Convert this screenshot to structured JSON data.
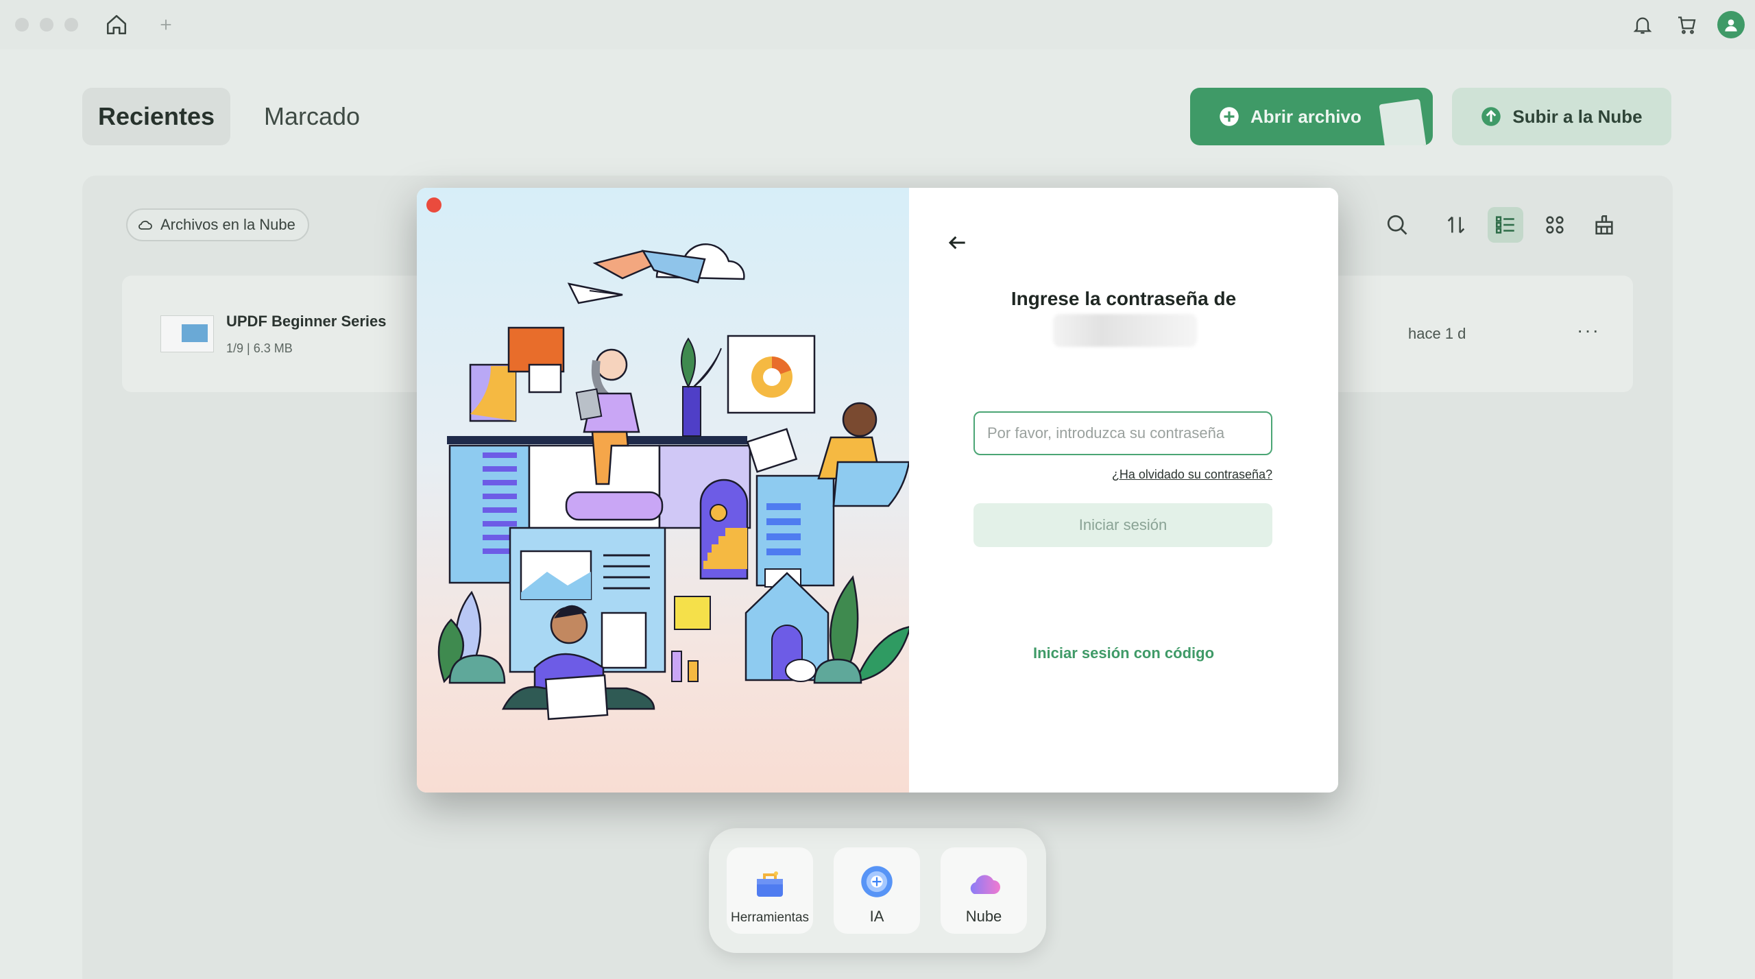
{
  "tabs": {
    "recent": "Recientes",
    "marked": "Marcado"
  },
  "actions": {
    "open_file": "Abrir archivo",
    "upload_cloud": "Subir a la Nube"
  },
  "filter": {
    "cloud_files": "Archivos en la Nube"
  },
  "file": {
    "name": "UPDF Beginner Series",
    "pages": "1/9",
    "size": "6.3 MB",
    "time": "hace 1 d",
    "more": "···"
  },
  "dock": {
    "tools": "Herramientas",
    "ai": "IA",
    "cloud": "Nube"
  },
  "modal": {
    "title": "Ingrese la contraseña de",
    "password_placeholder": "Por favor, introduzca su contraseña",
    "forgot": "¿Ha olvidado su contraseña?",
    "login": "Iniciar sesión",
    "login_code": "Iniciar sesión con código"
  },
  "colors": {
    "accent": "#3f9a67",
    "accent_light": "#cfe2d6",
    "close": "#ea4b3d"
  }
}
